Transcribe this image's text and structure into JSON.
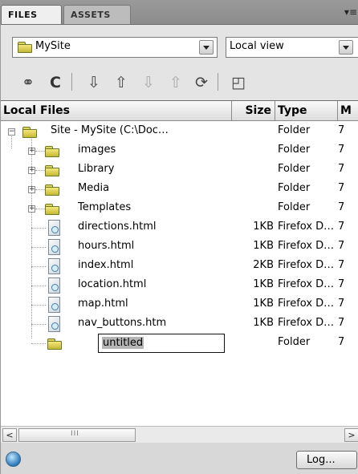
{
  "tabs": [
    {
      "label": "FILES",
      "active": true
    },
    {
      "label": "ASSETS",
      "active": false
    }
  ],
  "panel_menu_icon": "options-menu-icon",
  "site_select": {
    "value": "MySite",
    "icon": "folder-icon"
  },
  "view_select": {
    "value": "Local view"
  },
  "toolbar": {
    "buttons": [
      {
        "name": "connect-icon",
        "glyph": "⚭"
      },
      {
        "name": "refresh-icon",
        "glyph": "C"
      },
      {
        "name": "get-files-icon",
        "glyph": "⇩"
      },
      {
        "name": "put-files-icon",
        "glyph": "⇧"
      },
      {
        "name": "check-out-icon",
        "glyph": "⇩"
      },
      {
        "name": "check-in-icon",
        "glyph": "⇧"
      },
      {
        "name": "synchronize-icon",
        "glyph": "⟳"
      },
      {
        "name": "expand-view-icon",
        "glyph": "◰"
      }
    ]
  },
  "columns": {
    "local_files": "Local Files",
    "size": "Size",
    "type": "Type",
    "modified": "M"
  },
  "rows": [
    {
      "name": "Site - MySite (C:\\Doc…",
      "size": "",
      "type": "Folder",
      "modified": "7",
      "kind": "root"
    },
    {
      "name": "images",
      "size": "",
      "type": "Folder",
      "modified": "7",
      "kind": "folder"
    },
    {
      "name": "Library",
      "size": "",
      "type": "Folder",
      "modified": "7",
      "kind": "folder"
    },
    {
      "name": "Media",
      "size": "",
      "type": "Folder",
      "modified": "7",
      "kind": "folder"
    },
    {
      "name": "Templates",
      "size": "",
      "type": "Folder",
      "modified": "7",
      "kind": "folder"
    },
    {
      "name": "directions.html",
      "size": "1KB",
      "type": "Firefox D…",
      "modified": "7",
      "kind": "file"
    },
    {
      "name": "hours.html",
      "size": "1KB",
      "type": "Firefox D…",
      "modified": "7",
      "kind": "file"
    },
    {
      "name": "index.html",
      "size": "2KB",
      "type": "Firefox D…",
      "modified": "7",
      "kind": "file"
    },
    {
      "name": "location.html",
      "size": "1KB",
      "type": "Firefox D…",
      "modified": "7",
      "kind": "file"
    },
    {
      "name": "map.html",
      "size": "1KB",
      "type": "Firefox D…",
      "modified": "7",
      "kind": "file"
    },
    {
      "name": "nav_buttons.htm",
      "size": "1KB",
      "type": "Firefox D…",
      "modified": "7",
      "kind": "file"
    },
    {
      "name": "untitled",
      "size": "",
      "type": "Folder",
      "modified": "7",
      "kind": "editing"
    }
  ],
  "scrollbar": {
    "left_arrow": "<",
    "right_arrow": ">",
    "grip": "III"
  },
  "status": {
    "log_button": "Log...",
    "icon": "globe-icon"
  }
}
